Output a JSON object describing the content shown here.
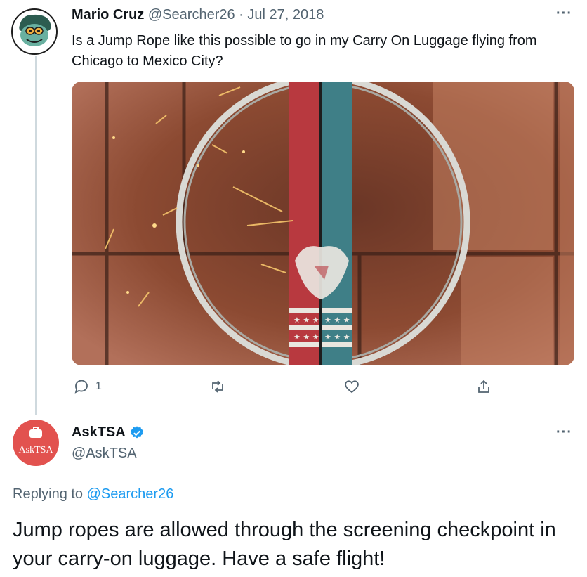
{
  "tweet1": {
    "author_name": "Mario Cruz",
    "handle": "@Searcher26",
    "separator": " · ",
    "date": "Jul 27, 2018",
    "text": "Is a Jump Rope like this possible to go in my Carry On Luggage flying from Chicago to Mexico City?",
    "more": "···",
    "reply_count": "1",
    "media": {
      "subject": "jump rope with red and blue handles on brick floor",
      "colors": {
        "brick": "#a85a3c",
        "handle_red": "#b8393f",
        "handle_blue": "#3f7f87"
      }
    }
  },
  "tweet2": {
    "author_name": "AskTSA",
    "verified_icon": "verified-badge-icon",
    "handle": "@AskTSA",
    "more": "···",
    "avatar_text": "AskTSA",
    "replying_prefix": "Replying to ",
    "replying_to": "@Searcher26",
    "text": "Jump ropes are allowed through the screening checkpoint in your carry-on luggage. Have a safe flight!"
  },
  "colors": {
    "accent": "#1d9bf0",
    "secondary_text": "#536471",
    "thread_line": "#cfd9de",
    "avatar_red": "#e2524f"
  }
}
